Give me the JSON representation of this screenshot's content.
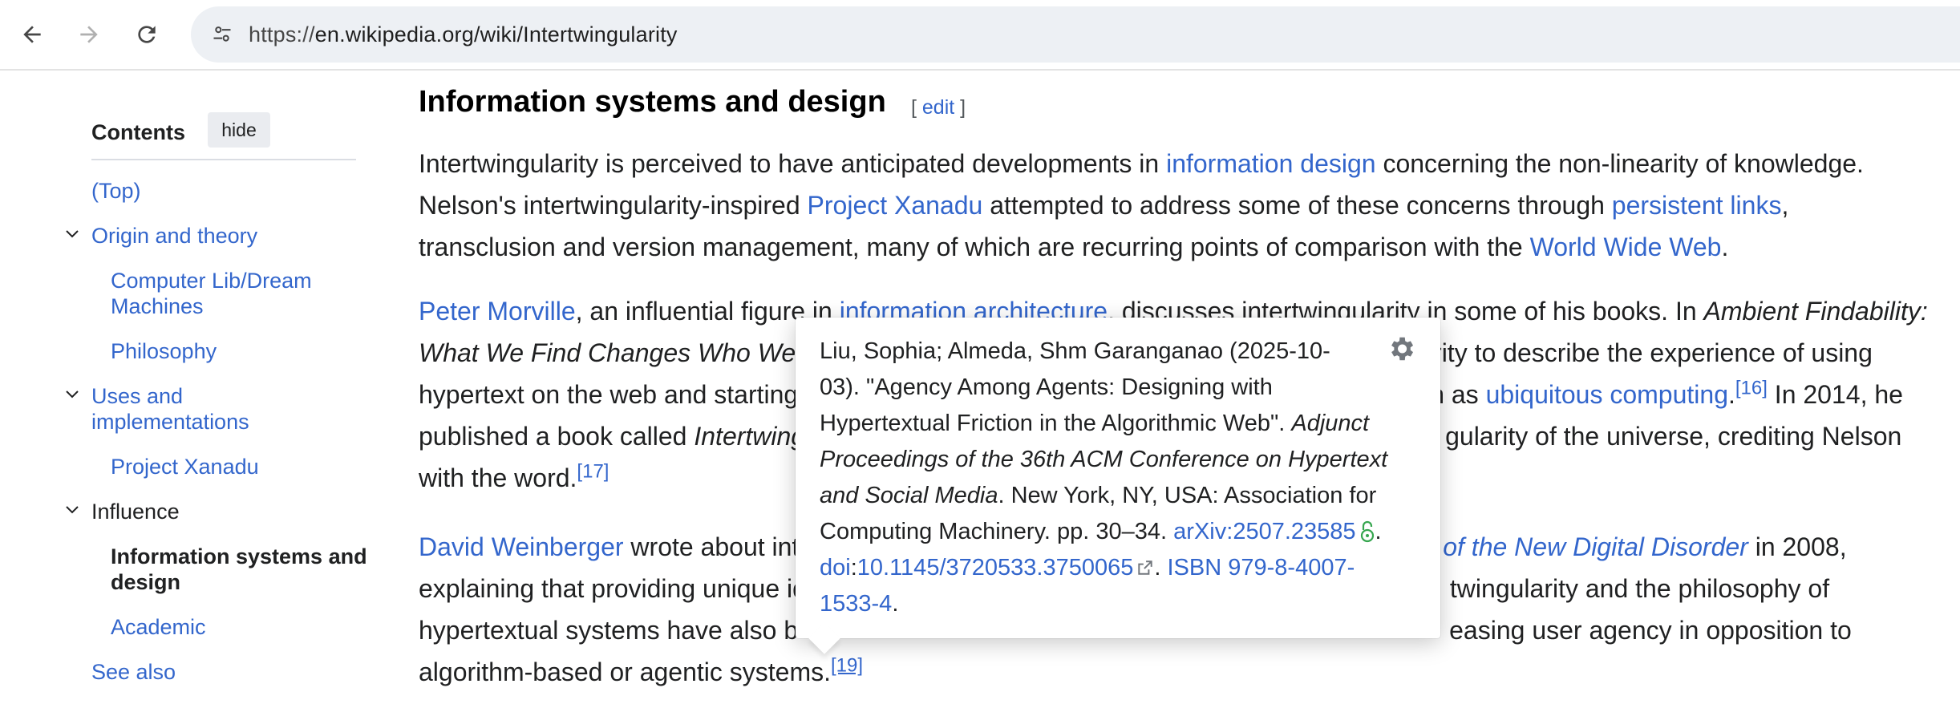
{
  "browser": {
    "url_scheme": "https://",
    "url_rest": "en.wikipedia.org/wiki/Intertwingularity"
  },
  "toc": {
    "title": "Contents",
    "hide_label": "hide",
    "items": {
      "top": "(Top)",
      "origin": "Origin and theory",
      "computer_lib_1": "Computer Lib/Dream",
      "computer_lib_2": "Machines",
      "philosophy": "Philosophy",
      "uses_1": "Uses and",
      "uses_2": "implementations",
      "xanadu": "Project Xanadu",
      "influence": "Influence",
      "info_systems_1": "Information systems and",
      "info_systems_2": "design",
      "academic": "Academic",
      "see_also": "See also"
    }
  },
  "article": {
    "heading": "Information systems and design",
    "edit_open": "[ ",
    "edit_label": "edit",
    "edit_close": " ]",
    "p1": {
      "l1a": "Intertwingularity is perceived to have anticipated developments in ",
      "l1_link": "information design",
      "l1b": " concerning the non-linearity of knowledge.",
      "l2a": "Nelson's intertwingularity-inspired ",
      "l2_link1": "Project Xanadu",
      "l2b": " attempted to address some of these concerns through ",
      "l2_link2": "persistent links",
      "l2c": ",",
      "l3a": "transclusion and version management, many of which are recurring points of comparison with the ",
      "l3_link": "World Wide Web",
      "l3b": "."
    },
    "p2": {
      "l1_link1": "Peter Morville",
      "l1a": ", an influential figure in ",
      "l1_link2": "information architecture",
      "l1b": ", discusses intertwingularity in some of his books. In ",
      "l1_em": "Ambient Findability:",
      "l2_em": "What We Find Changes Who We",
      "l2_tail": "larity to describe the experience of using",
      "l3a": "hypertext on the web and starting",
      "l3_gap": "n as ",
      "l3_link": "ubiquitous computing",
      "l3b": ".",
      "l3_ref": "[16]",
      "l3c": " In 2014, he",
      "l4a": "published a book called ",
      "l4_em": "Intertwing",
      "l4_tail": "gularity of the universe, crediting Nelson",
      "l5a": "with the word.",
      "l5_ref": "[17]"
    },
    "p3": {
      "l1_link1": "David Weinberger",
      "l1a": " wrote about int",
      "l1_em_link": "y of the New Digital Disorder",
      "l1b": " in 2008,",
      "l2a": "explaining that providing unique id",
      "l2_tail": "twingularity and the philosophy of",
      "l3a": "hypertextual systems have also b",
      "l3_tail": "easing user agency in opposition to",
      "l4a": "algorithm-based or agentic systems.",
      "l4_ref": "[19]"
    }
  },
  "popup": {
    "l1": "Liu, Sophia; Almeda, Shm Garanganao (2025-10-",
    "l2": "03). \"Agency Among Agents: Designing with",
    "l3a": "Hypertextual Friction in the Algorithmic Web\". ",
    "l3_em": "Adjunct",
    "l4_em": "Proceedings of the 36th ACM Conference on Hypertext",
    "l5_em": "and Social Media",
    "l5b": ". New York, NY, USA: Association for",
    "l6a": "Computing Machinery. pp. 30–34. ",
    "l6_link1": "arXiv",
    "l6_colon": ":",
    "l6_link2": "2507.23585",
    "l6b": ".",
    "l7_link1": "doi",
    "l7_colon": ":",
    "l7_link2": "10.1145/3720533.3750065",
    "l7b": ". ",
    "l7_link3": "ISBN",
    "l7_space": " ",
    "l7_link4": "979-8-4007-",
    "l8_link4": "1533-4",
    "l8b": "."
  },
  "colors": {
    "link": "#3366cc",
    "text": "#202122",
    "open_access_lock": "#36a64f"
  },
  "icons": [
    "back-arrow-icon",
    "forward-arrow-icon",
    "reload-icon",
    "site-info-icon",
    "chevron-down-icon",
    "gear-icon",
    "external-link-icon",
    "open-access-lock-icon"
  ]
}
